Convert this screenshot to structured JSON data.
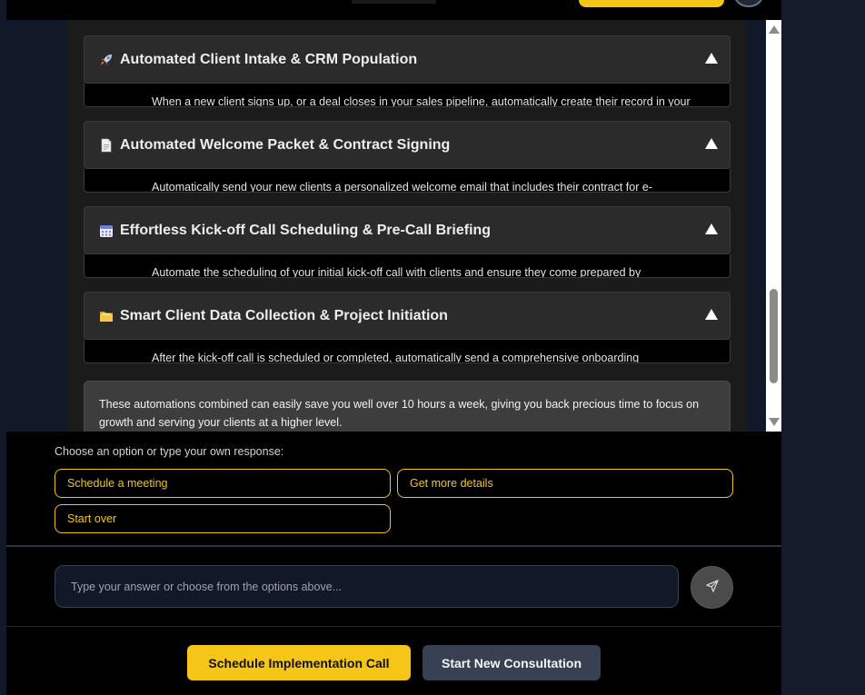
{
  "accordion": [
    {
      "icon": "rocket-icon",
      "title": "Automated Client Intake & CRM Population",
      "preview": "When a new client signs up, or a deal closes in your sales pipeline, automatically create their record in your"
    },
    {
      "icon": "document-icon",
      "title": "Automated Welcome Packet & Contract Signing",
      "preview": "Automatically send your new clients a personalized welcome email that includes their contract for e-"
    },
    {
      "icon": "calendar-icon",
      "title": "Effortless Kick-off Call Scheduling & Pre-Call Briefing",
      "preview": "Automate the scheduling of your initial kick-off call with clients and ensure they come prepared by"
    },
    {
      "icon": "folder-icon",
      "title": "Smart Client Data Collection & Project Initiation",
      "preview": "After the kick-off call is scheduled or completed, automatically send a comprehensive onboarding"
    }
  ],
  "summary": "These automations combined can easily save you well over 10 hours a week, giving you back precious time to focus on growth and serving your clients at a higher level.",
  "options": {
    "label": "Choose an option or type your own response:",
    "items": [
      "Schedule a meeting",
      "Get more details",
      "Start over"
    ]
  },
  "input": {
    "placeholder": "Type your answer or choose from the options above..."
  },
  "actions": {
    "primary": "Schedule Implementation Call",
    "secondary": "Start New Consultation"
  },
  "colors": {
    "accent": "#f5c518",
    "background": "#000000",
    "panel": "#1b1b1b",
    "secondary_button": "#374151"
  }
}
